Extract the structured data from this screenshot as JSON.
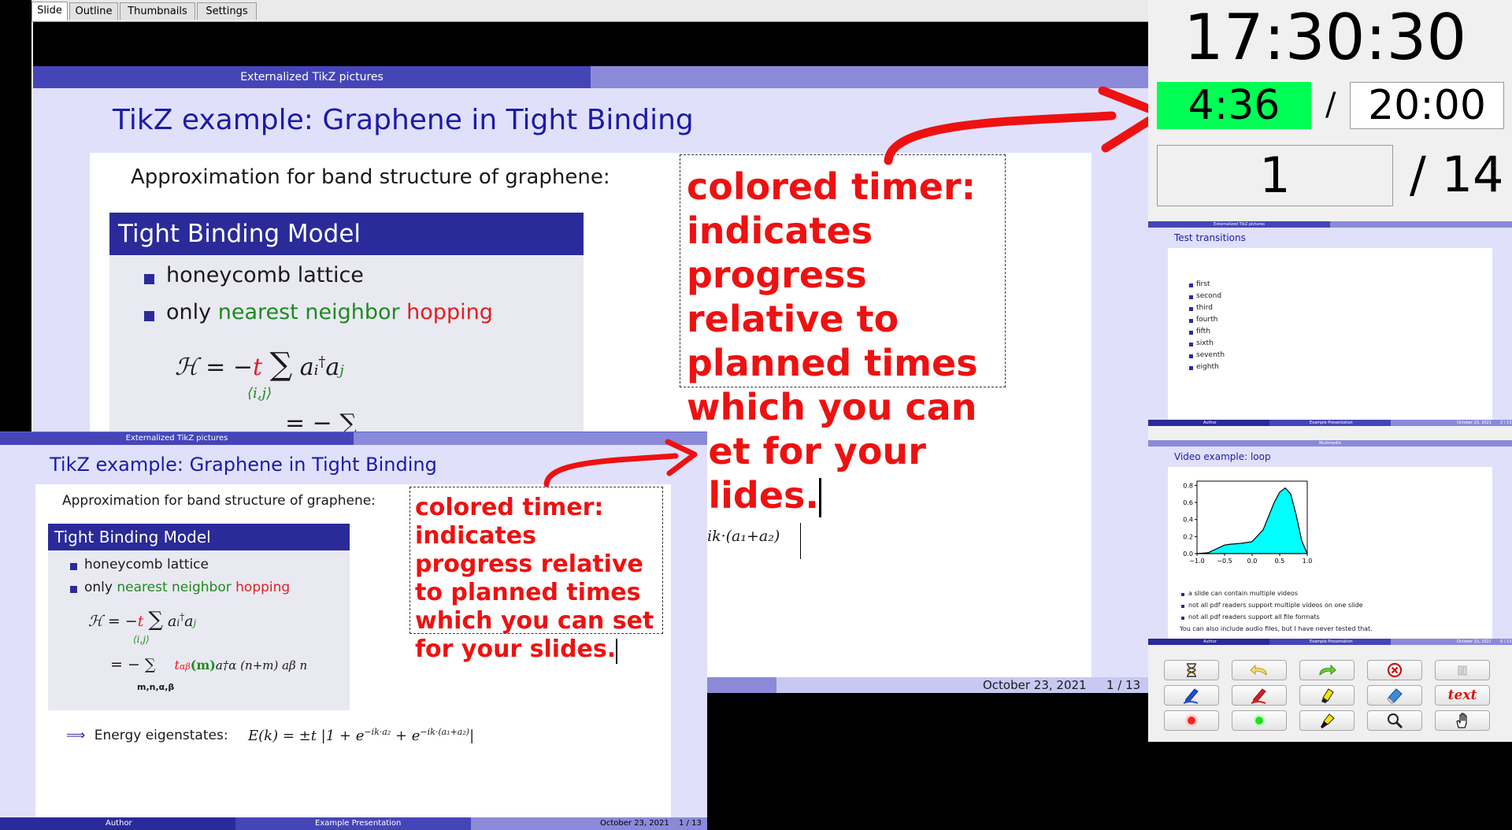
{
  "tabs": [
    "Slide",
    "Outline",
    "Thumbnails",
    "Settings"
  ],
  "active_tab": "Slide",
  "clock": "17:30:30",
  "timer": {
    "elapsed": "4:36",
    "separator": "/",
    "planned": "20:00",
    "elapsed_color": "#00ff55"
  },
  "page": {
    "current": "1",
    "total": "/ 14"
  },
  "slide": {
    "section": "Externalized TikZ pictures",
    "title": "TikZ example: Graphene in Tight Binding",
    "intro": "Approximation for band structure of graphene:",
    "block_title": "Tight Binding Model",
    "bullets": {
      "b1": "honeycomb lattice",
      "b2_pre": "only",
      "b2_green": "nearest neighbor",
      "b2_red": "hopping"
    },
    "formula1": {
      "lhs": "ℋ = −",
      "t": "t",
      "sum": "∑",
      "sub": "⟨i,j⟩",
      "ops": "a",
      "i": "i",
      "dag": "†",
      "j": "j"
    },
    "formula2": {
      "lhs": "= − ∑",
      "sub": "m,n,α,β",
      "coef": "t",
      "coef_sub": "αβ",
      "arg": "(m)",
      "rest": "a†α (n+m) aβ n"
    },
    "energy": {
      "arrow": "⟹",
      "label": "Energy eigenstates:",
      "formula": "E(k) = ±t |1 + e",
      "exp1": "−ik·a₂",
      "plus": " + e",
      "exp2": "−ik·(a₁+a₂)",
      "end": "|"
    },
    "big_partial_formula": "ik·(a₁+a₂)",
    "note": "colored timer: indicates progress relative to planned times which you can set for your slides.",
    "footer": {
      "author": "Author",
      "presentation": "Example Presentation",
      "date": "October 23, 2021",
      "page": "1 / 13"
    },
    "note_color": "#ee1111",
    "header_color": "#4545b8"
  },
  "thumbnails": [
    {
      "section": "Externalized TikZ pictures",
      "title": "Test transitions",
      "items": [
        "first",
        "second",
        "third",
        "fourth",
        "fifth",
        "sixth",
        "seventh",
        "eighth"
      ],
      "footer": {
        "author": "Author",
        "presentation": "Example Presentation",
        "date": "October 23, 2021",
        "page": "2 / 13"
      }
    },
    {
      "section": "Multimedia",
      "title": "Video example: loop",
      "chart_data": {
        "type": "area",
        "x": [
          -1.0,
          -0.8,
          -0.6,
          -0.5,
          -0.4,
          -0.2,
          0.0,
          0.2,
          0.4,
          0.5,
          0.6,
          0.7,
          0.8,
          0.9,
          1.0
        ],
        "y": [
          0.0,
          0.01,
          0.07,
          0.1,
          0.11,
          0.12,
          0.14,
          0.28,
          0.6,
          0.72,
          0.77,
          0.7,
          0.45,
          0.15,
          0.0
        ],
        "xlim": [
          -1.0,
          1.0
        ],
        "ylim": [
          0.0,
          0.85
        ],
        "x_ticks": [
          "−1.0",
          "−0.5",
          "0.0",
          "0.5",
          "1.0"
        ],
        "y_ticks": [
          "0.0",
          "0.2",
          "0.4",
          "0.6",
          "0.8"
        ],
        "fill": "#00ffff",
        "title": "",
        "xlabel": "",
        "ylabel": ""
      },
      "items": [
        "a slide can contain multiple videos",
        "not all pdf readers support multiple videos on one slide",
        "not all pdf readers support all file formats"
      ],
      "note": "You can also include audio files, but I have never tested that.",
      "footer": {
        "author": "Author",
        "presentation": "Example Presentation",
        "date": "October 23, 2021",
        "page": "6 / 13"
      }
    }
  ],
  "tools": [
    "hourglass-icon",
    "undo-arrow-icon",
    "redo-arrow-icon",
    "close-circle-icon",
    "pause-icon",
    "blue-pen-icon",
    "red-pen-icon",
    "highlighter-icon",
    "eraser-icon",
    "text-tool-icon",
    "red-pointer-icon",
    "green-pointer-icon",
    "torch-icon",
    "magnifier-icon",
    "hand-drag-icon"
  ],
  "text_tool_label": "text"
}
